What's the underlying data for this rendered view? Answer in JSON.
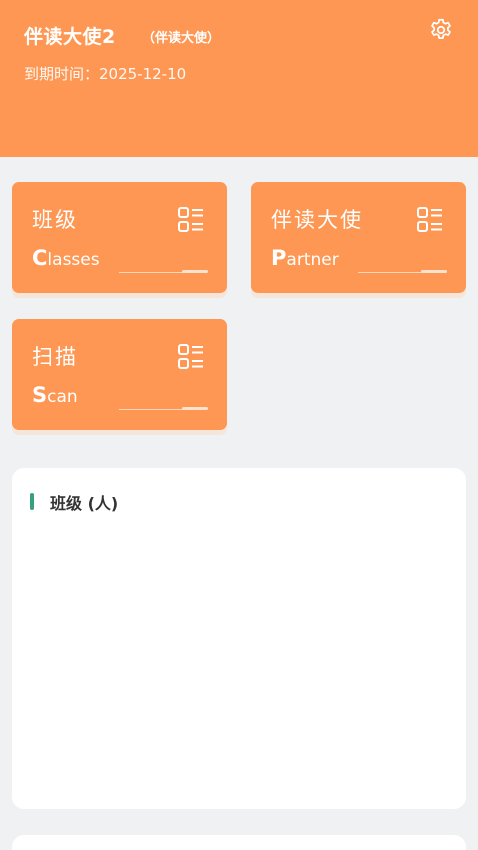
{
  "header": {
    "user_name": "伴读大使2",
    "user_role": "（伴读大使）",
    "expire_text": "到期时间：2025-12-10",
    "bg_color": "#fd9753"
  },
  "settings": {
    "icon": "gear-icon"
  },
  "cards": [
    {
      "title": "班级",
      "sub_initial": "C",
      "sub_rest": "lasses",
      "icon": "menu-list-icon"
    },
    {
      "title": "伴读大使",
      "sub_initial": "P",
      "sub_rest": "artner",
      "icon": "menu-list-icon"
    },
    {
      "title": "扫描",
      "sub_initial": "S",
      "sub_rest": "can",
      "icon": "menu-list-icon"
    }
  ],
  "panel": {
    "title": "班级 (人)",
    "accent_color": "#38a07a"
  }
}
